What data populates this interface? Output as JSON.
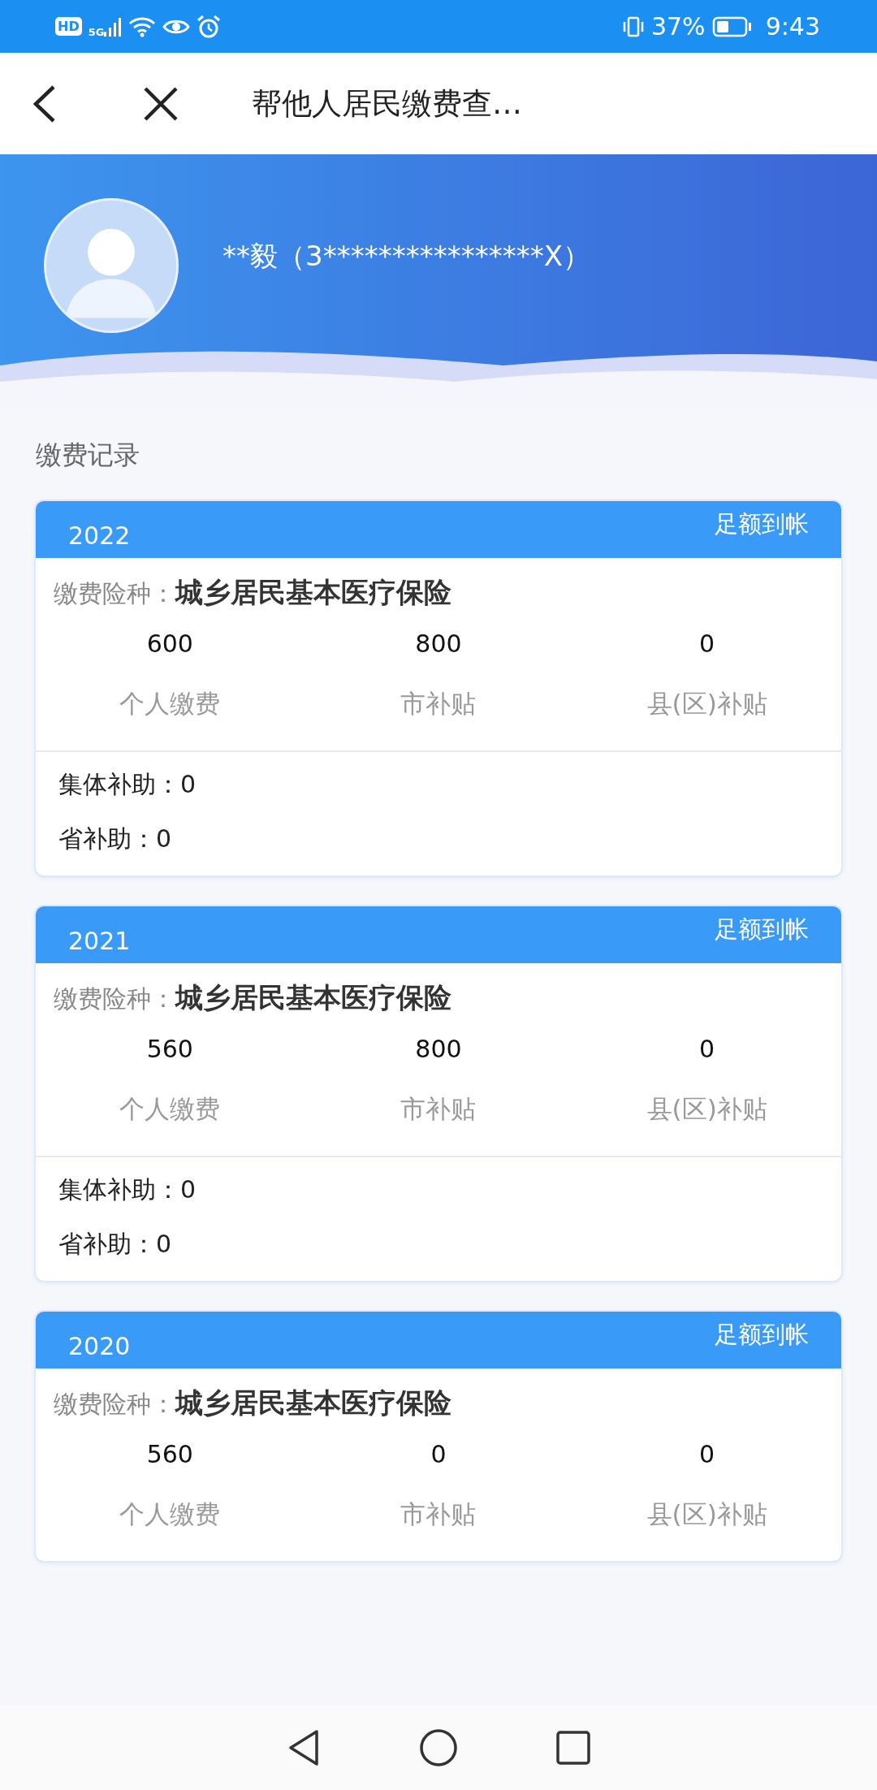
{
  "status_bar": {
    "network_badges": [
      "HD",
      "5G"
    ],
    "battery": "37%",
    "time": "9:43"
  },
  "title_bar": {
    "title": "帮他人居民缴费查…"
  },
  "profile": {
    "name": "**毅（3****************X）"
  },
  "section_title": "缴费记录",
  "records": [
    {
      "year": "2022",
      "status": "足额到帐",
      "type_label": "缴费险种：",
      "type": "城乡居民基本医疗保险",
      "amounts": [
        {
          "value": "600",
          "label": "个人缴费"
        },
        {
          "value": "800",
          "label": "市补贴"
        },
        {
          "value": "0",
          "label": "县(区)补贴"
        }
      ],
      "extras": [
        {
          "label": "集体补助：",
          "value": "0"
        },
        {
          "label": "省补助：",
          "value": "0"
        }
      ]
    },
    {
      "year": "2021",
      "status": "足额到帐",
      "type_label": "缴费险种：",
      "type": "城乡居民基本医疗保险",
      "amounts": [
        {
          "value": "560",
          "label": "个人缴费"
        },
        {
          "value": "800",
          "label": "市补贴"
        },
        {
          "value": "0",
          "label": "县(区)补贴"
        }
      ],
      "extras": [
        {
          "label": "集体补助：",
          "value": "0"
        },
        {
          "label": "省补助：",
          "value": "0"
        }
      ]
    },
    {
      "year": "2020",
      "status": "足额到帐",
      "type_label": "缴费险种：",
      "type": "城乡居民基本医疗保险",
      "amounts": [
        {
          "value": "560",
          "label": "个人缴费"
        },
        {
          "value": "0",
          "label": "市补贴"
        },
        {
          "value": "0",
          "label": "县(区)补贴"
        }
      ]
    }
  ]
}
